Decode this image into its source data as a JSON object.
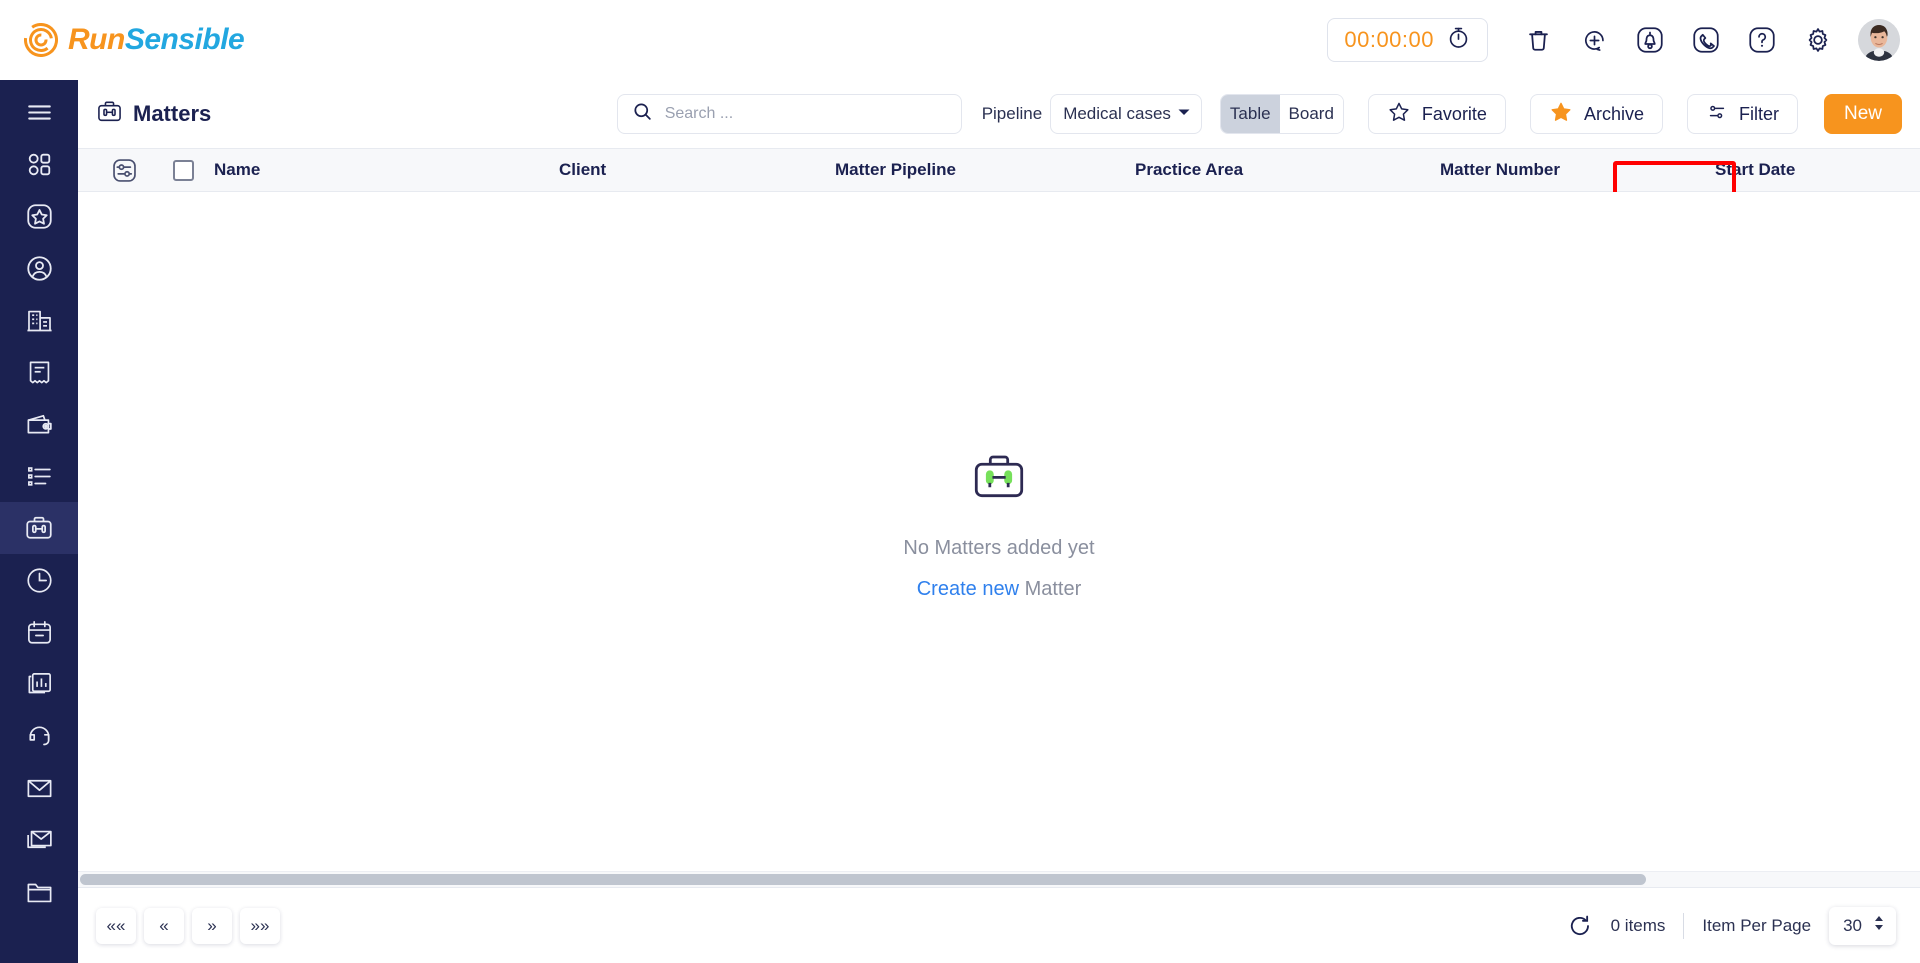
{
  "brand": {
    "name_part1": "Run",
    "name_part2": "Sensible",
    "orange": "#F7941E",
    "blue": "#22A7E0"
  },
  "topbar": {
    "timer_value": "00:00:00",
    "icons": [
      {
        "name": "stopwatch-icon"
      },
      {
        "name": "trash-icon"
      },
      {
        "name": "add-circle-icon"
      },
      {
        "name": "bell-icon"
      },
      {
        "name": "phone-icon"
      },
      {
        "name": "help-icon"
      },
      {
        "name": "gear-icon"
      }
    ],
    "avatar_alt": "User avatar"
  },
  "sidebar": {
    "items": [
      {
        "icon": "hamburger-menu-icon",
        "active": false
      },
      {
        "icon": "dashboard-grid-icon",
        "active": false
      },
      {
        "icon": "star-square-icon",
        "active": false
      },
      {
        "icon": "person-icon",
        "active": false
      },
      {
        "icon": "building-icon",
        "active": false
      },
      {
        "icon": "receipt-icon",
        "active": false
      },
      {
        "icon": "wallet-icon",
        "active": false
      },
      {
        "icon": "list-icon",
        "active": false
      },
      {
        "icon": "briefcase-icon",
        "active": true
      },
      {
        "icon": "clock-icon",
        "active": false
      },
      {
        "icon": "calendar-icon",
        "active": false
      },
      {
        "icon": "reports-chart-icon",
        "active": false
      },
      {
        "icon": "headset-icon",
        "active": false
      },
      {
        "icon": "envelope-icon",
        "active": false
      },
      {
        "icon": "mail-stack-icon",
        "active": false
      },
      {
        "icon": "folder-icon",
        "active": false
      }
    ]
  },
  "page": {
    "title": "Matters",
    "title_icon": "briefcase-icon"
  },
  "search": {
    "placeholder": "Search ...",
    "value": ""
  },
  "pipeline": {
    "label": "Pipeline",
    "selected": "Medical cases"
  },
  "view_toggle": {
    "table_label": "Table",
    "board_label": "Board",
    "active": "Table"
  },
  "actions": {
    "favorite_label": "Favorite",
    "archive_label": "Archive",
    "filter_label": "Filter",
    "new_label": "New",
    "archive_highlighted": true,
    "highlight_color": "#FF0000"
  },
  "table": {
    "columns": [
      {
        "key": "name",
        "label": "Name"
      },
      {
        "key": "client",
        "label": "Client"
      },
      {
        "key": "pipeline",
        "label": "Matter Pipeline"
      },
      {
        "key": "area",
        "label": "Practice Area"
      },
      {
        "key": "number",
        "label": "Matter Number"
      },
      {
        "key": "date",
        "label": "Start Date"
      }
    ],
    "rows": []
  },
  "empty_state": {
    "icon": "briefcase-empty-icon",
    "message": "No Matters added yet",
    "link_text": "Create new",
    "link_suffix": " Matter"
  },
  "footer": {
    "pager": [
      {
        "name": "first-page-button",
        "label": "««"
      },
      {
        "name": "prev-page-button",
        "label": "«"
      },
      {
        "name": "next-page-button",
        "label": "»"
      },
      {
        "name": "last-page-button",
        "label": "»»"
      }
    ],
    "items_count": "0 items",
    "item_per_page_label": "Item Per Page",
    "item_per_page_value": "30"
  }
}
